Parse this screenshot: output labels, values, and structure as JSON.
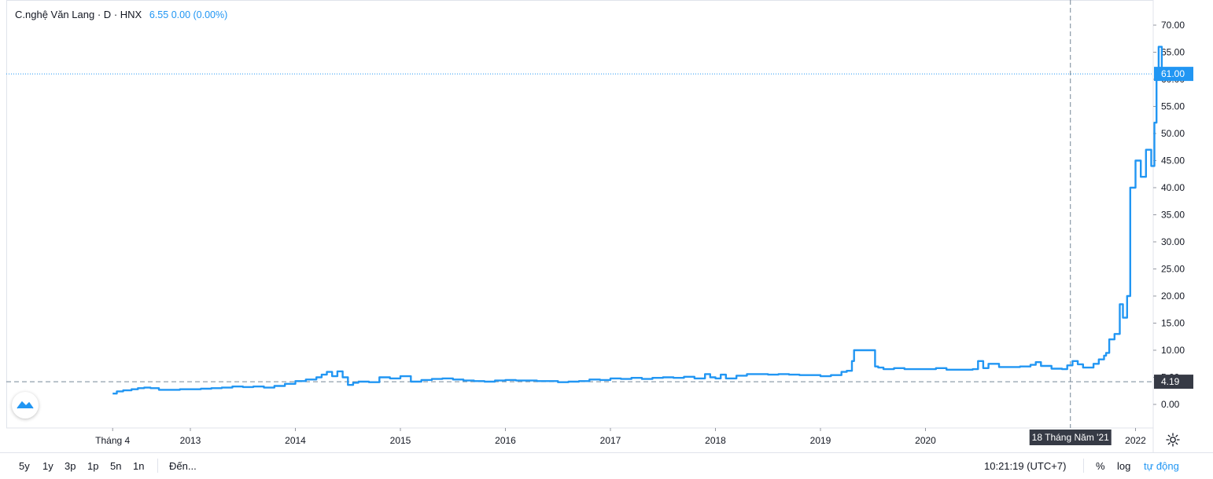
{
  "legend": {
    "symbol": "C.nghệ Văn Lang",
    "separator1": "·",
    "interval": "D",
    "separator2": "·",
    "exchange": "HNX",
    "price": "6.55",
    "change": "0.00",
    "change_pct": "(0.00%)"
  },
  "colors": {
    "line": "#2196f3",
    "last_price_label": "#2196f3",
    "crosshair_label": "#363a45",
    "grid_border": "#e0e3eb",
    "accent": "#2196f3"
  },
  "chart_data": {
    "type": "line",
    "series": [
      {
        "values_x": [
          2012.26,
          2012.3,
          2012.36,
          2012.44,
          2012.5,
          2012.56,
          2012.62,
          2012.7,
          2012.8,
          2012.9,
          2013.0,
          2013.1,
          2013.2,
          2013.3,
          2013.4,
          2013.5,
          2013.6,
          2013.7,
          2013.8,
          2013.9,
          2014.0,
          2014.1,
          2014.2,
          2014.25,
          2014.3,
          2014.35,
          2014.4,
          2014.45,
          2014.5,
          2014.55,
          2014.6,
          2014.7,
          2014.8,
          2014.9,
          2015.0,
          2015.1,
          2015.2,
          2015.3,
          2015.4,
          2015.5,
          2015.6,
          2015.7,
          2015.8,
          2015.9,
          2016.0,
          2016.1,
          2016.2,
          2016.3,
          2016.4,
          2016.5,
          2016.6,
          2016.7,
          2016.8,
          2016.9,
          2017.0,
          2017.1,
          2017.2,
          2017.3,
          2017.4,
          2017.5,
          2017.6,
          2017.7,
          2017.8,
          2017.9,
          2017.95,
          2018.0,
          2018.05,
          2018.1,
          2018.2,
          2018.3,
          2018.4,
          2018.5,
          2018.6,
          2018.7,
          2018.8,
          2018.9,
          2019.0,
          2019.1,
          2019.2,
          2019.25,
          2019.3,
          2019.32,
          2019.4,
          2019.5,
          2019.52,
          2019.55,
          2019.6,
          2019.7,
          2019.8,
          2019.9,
          2020.0,
          2020.1,
          2020.2,
          2020.3,
          2020.4,
          2020.45,
          2020.5,
          2020.55,
          2020.6,
          2020.7,
          2020.8,
          2020.9,
          2021.0,
          2021.05,
          2021.1,
          2021.2,
          2021.3,
          2021.35,
          2021.4,
          2021.45,
          2021.5,
          2021.6,
          2021.65,
          2021.7,
          2021.72,
          2021.75,
          2021.8,
          2021.85,
          2021.88,
          2021.92,
          2021.95,
          2022.0,
          2022.05,
          2022.1,
          2022.15,
          2022.18,
          2022.2,
          2022.22,
          2022.25,
          2022.27
        ],
        "values": [
          2.0,
          2.4,
          2.6,
          2.8,
          3.0,
          3.1,
          3.0,
          2.7,
          2.7,
          2.8,
          2.8,
          2.9,
          3.0,
          3.1,
          3.3,
          3.2,
          3.3,
          3.1,
          3.4,
          3.8,
          4.3,
          4.6,
          5.0,
          5.5,
          6.0,
          5.2,
          6.1,
          5.0,
          3.6,
          4.0,
          4.2,
          4.1,
          5.0,
          4.8,
          5.2,
          4.2,
          4.5,
          4.7,
          4.8,
          4.6,
          4.4,
          4.3,
          4.2,
          4.4,
          4.5,
          4.4,
          4.4,
          4.3,
          4.3,
          4.1,
          4.2,
          4.3,
          4.6,
          4.5,
          4.8,
          4.7,
          4.9,
          4.7,
          4.9,
          5.0,
          4.9,
          5.1,
          4.8,
          5.6,
          5.0,
          4.8,
          5.5,
          4.8,
          5.3,
          5.6,
          5.6,
          5.5,
          5.6,
          5.5,
          5.4,
          5.4,
          5.2,
          5.4,
          6.0,
          6.2,
          8.0,
          10.0,
          10.0,
          10.0,
          7.0,
          6.8,
          6.5,
          6.7,
          6.5,
          6.5,
          6.5,
          6.7,
          6.4,
          6.4,
          6.4,
          6.5,
          8.0,
          6.7,
          7.5,
          6.9,
          6.9,
          7.0,
          7.3,
          7.8,
          7.1,
          6.6,
          6.5,
          7.2,
          8.0,
          7.4,
          6.8,
          7.5,
          8.3,
          9.0,
          9.5,
          12.0,
          13.0,
          18.5,
          16.0,
          20.0,
          40.0,
          45.0,
          42.0,
          47.0,
          44.0,
          52.0,
          60.5,
          66.0,
          60.0,
          61.0
        ]
      }
    ],
    "x_ticks": [
      "Tháng 4",
      "2013",
      "2014",
      "2015",
      "2016",
      "2017",
      "2018",
      "2019",
      "2020",
      "2022"
    ],
    "y_ticks": [
      "0.00",
      "5.00",
      "10.00",
      "15.00",
      "20.00",
      "25.00",
      "30.00",
      "35.00",
      "40.00",
      "45.00",
      "50.00",
      "55.00",
      "60.00",
      "65.00",
      "70.00"
    ],
    "ylim": [
      -2.0,
      74.0
    ],
    "last_price": 61.0,
    "last_price_label": "61.00",
    "crosshair": {
      "y_value": 4.19,
      "y_label": "4.19",
      "x_value": 2021.38,
      "x_label": "18 Tháng Năm '21"
    },
    "grid": false
  },
  "bottom_bar": {
    "ranges": [
      "5y",
      "1y",
      "3p",
      "1p",
      "5n",
      "1n"
    ],
    "goto": "Đến...",
    "time": "10:21:19 (UTC+7)",
    "percent": "%",
    "log": "log",
    "auto": "tự động"
  }
}
